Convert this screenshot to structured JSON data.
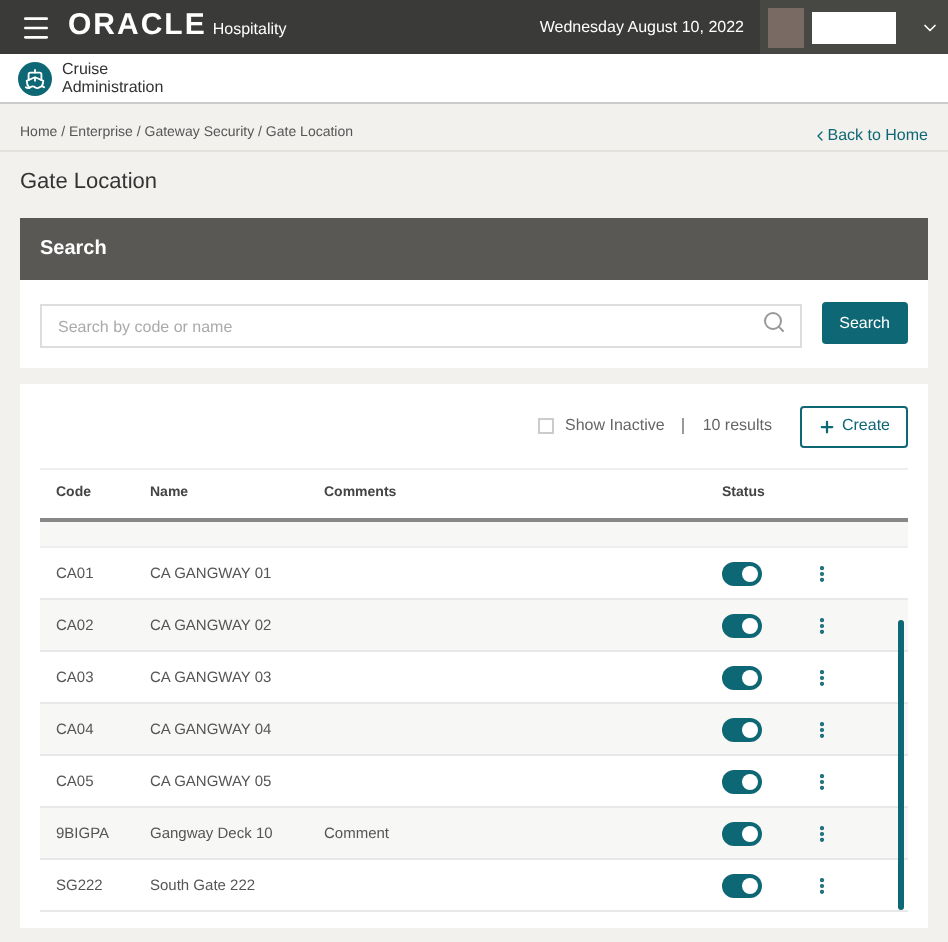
{
  "header": {
    "brand": "ORACLE",
    "brand_suffix": "Hospitality",
    "date": "Wednesday August 10, 2022"
  },
  "app": {
    "title": "Cruise",
    "subtitle": "Administration"
  },
  "breadcrumb": "Home / Enterprise / Gateway Security / Gate Location",
  "back_link": "Back to Home",
  "page_title": "Gate Location",
  "search": {
    "title": "Search",
    "placeholder": "Search by code or name",
    "button": "Search"
  },
  "toolbar": {
    "show_inactive": {
      "label": "Show Inactive",
      "checked": false
    },
    "results": "10 results",
    "create": "Create"
  },
  "table": {
    "columns": [
      "Code",
      "Name",
      "Comments",
      "Status"
    ],
    "rows": [
      {
        "code": "CA01",
        "name": "CA GANGWAY 01",
        "comments": "",
        "active": true
      },
      {
        "code": "CA02",
        "name": "CA GANGWAY 02",
        "comments": "",
        "active": true
      },
      {
        "code": "CA03",
        "name": "CA GANGWAY 03",
        "comments": "",
        "active": true
      },
      {
        "code": "CA04",
        "name": "CA GANGWAY 04",
        "comments": "",
        "active": true
      },
      {
        "code": "CA05",
        "name": "CA GANGWAY 05",
        "comments": "",
        "active": true
      },
      {
        "code": "9BIGPA",
        "name": "Gangway Deck 10",
        "comments": "Comment",
        "active": true
      },
      {
        "code": "SG222",
        "name": "South Gate 222",
        "comments": "",
        "active": true
      }
    ]
  }
}
